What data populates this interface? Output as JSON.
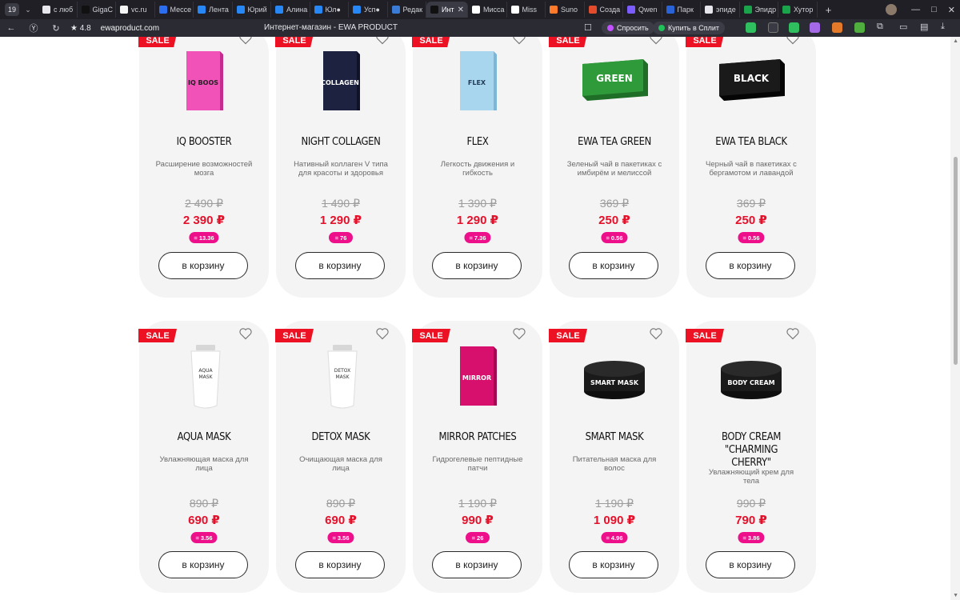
{
  "browser": {
    "tab_count": "19",
    "tabs": [
      {
        "label": "с люб",
        "color": "#e6e6ec"
      },
      {
        "label": "GigaC",
        "color": "#111111"
      },
      {
        "label": "vc.ru",
        "color": "#f5f5f5"
      },
      {
        "label": "Мессе",
        "color": "#2b6ef0"
      },
      {
        "label": "Лента",
        "color": "#2787f5"
      },
      {
        "label": "Юрий",
        "color": "#2787f5"
      },
      {
        "label": "Алина",
        "color": "#2787f5"
      },
      {
        "label": "Юл●",
        "color": "#2787f5"
      },
      {
        "label": "Усп●",
        "color": "#2787f5"
      },
      {
        "label": "Редак",
        "color": "#3a7bd5"
      },
      {
        "label": "Инт",
        "color": "#111111",
        "active": true
      },
      {
        "label": "Мисса",
        "color": "#ffffff"
      },
      {
        "label": "Miss",
        "color": "#ffffff"
      },
      {
        "label": "Suno",
        "color": "#ff7a2a"
      },
      {
        "label": "Созда",
        "color": "#e24b2b"
      },
      {
        "label": "Qwen",
        "color": "#7b5cff"
      },
      {
        "label": "Парк",
        "color": "#2a62d8"
      },
      {
        "label": "эпиде",
        "color": "#e6e6ec"
      },
      {
        "label": "Эпидр",
        "color": "#19a34a"
      },
      {
        "label": "Хутор",
        "color": "#19a34a"
      }
    ],
    "rating": "4.8",
    "url": "ewaproduct.com",
    "page_title": "Интернет-магазин - EWA PRODUCT",
    "ask_label": "Спросить",
    "split_label": "Купить в Сплит"
  },
  "shop": {
    "sale_label": "SALE",
    "cart_label": "в корзину",
    "products": [
      {
        "name": "IQ BOOSTER",
        "desc": "Расширение возможностей мозга",
        "old_price": "2 490 ₽",
        "price": "2 390 ₽",
        "badge": "= 13.36",
        "img": "box-pink",
        "img_text": "IQ BOOSTER"
      },
      {
        "name": "NIGHT COLLAGEN",
        "desc": "Нативный коллаген V типа для красоты и здоровья",
        "old_price": "1 490 ₽",
        "price": "1 290 ₽",
        "badge": "= 76",
        "img": "box-navy",
        "img_text": "COLLAGEN"
      },
      {
        "name": "FLEX",
        "desc": "Легкость движения и гибкость",
        "old_price": "1 390 ₽",
        "price": "1 290 ₽",
        "badge": "= 7.36",
        "img": "box-lightblue",
        "img_text": "FLEX"
      },
      {
        "name": "EWA TEA GREEN",
        "desc": "Зеленый чай в пакетиках с имбирём и мелиссой",
        "old_price": "369 ₽",
        "price": "250 ₽",
        "badge": "= 0.56",
        "img": "box-green",
        "img_text": "GREEN"
      },
      {
        "name": "EWA TEA BLACK",
        "desc": "Черный чай в пакетиках с бергамотом и лавандой",
        "old_price": "369 ₽",
        "price": "250 ₽",
        "badge": "= 0.56",
        "img": "box-black",
        "img_text": "BLACK"
      },
      {
        "name": "AQUA MASK",
        "desc": "Увлажняющая маска для лица",
        "old_price": "890 ₽",
        "price": "690 ₽",
        "badge": "= 3.56",
        "img": "tube-white",
        "img_text": "AQUA MASK"
      },
      {
        "name": "DETOX MASK",
        "desc": "Очищающая маска для лица",
        "old_price": "890 ₽",
        "price": "690 ₽",
        "badge": "= 3.56",
        "img": "tube-white",
        "img_text": "DETOX MASK"
      },
      {
        "name": "MIRROR PATCHES",
        "desc": "Гидрогелевые пептидные патчи",
        "old_price": "1 190 ₽",
        "price": "990 ₽",
        "badge": "= 26",
        "img": "box-magenta",
        "img_text": "MIRROR PATCHES"
      },
      {
        "name": "SMART MASK",
        "desc": "Питательная маска для волос",
        "old_price": "1 190 ₽",
        "price": "1 090 ₽",
        "badge": "= 4.96",
        "img": "jar-black",
        "img_text": "SMART MASK"
      },
      {
        "name": "BODY CREAM \"CHARMING CHERRY\"",
        "desc": "Увлажняющий крем для тела",
        "old_price": "990 ₽",
        "price": "790 ₽",
        "badge": "= 3.86",
        "img": "jar-black",
        "img_text": "BODY CREAM"
      }
    ]
  },
  "colors": {
    "sale": "#ec1224",
    "price": "#e5102a",
    "badge": "#ee0f8a",
    "card_bg": "#f4f4f4"
  }
}
